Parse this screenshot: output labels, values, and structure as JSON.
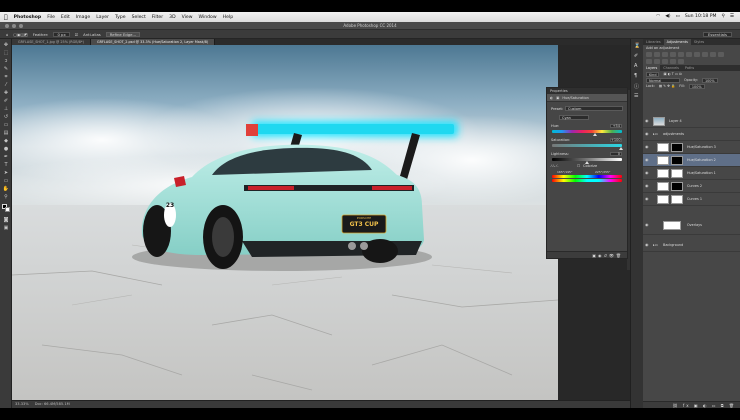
{
  "menubar": {
    "app_name": "Photoshop",
    "items": [
      "File",
      "Edit",
      "Image",
      "Layer",
      "Type",
      "Select",
      "Filter",
      "3D",
      "View",
      "Window",
      "Help"
    ],
    "clock": "Sun 10:18 PM"
  },
  "window": {
    "title": "Adobe Photoshop CC 2014"
  },
  "options": {
    "feather_label": "Feather:",
    "feather_value": "0 px",
    "antialias_label": "Anti-alias",
    "refine_edge": "Refine Edge...",
    "workspace": "Essentials"
  },
  "tabs": [
    {
      "label": "GRFLASE_SHOT_1.jpg @ 25% (RGB/8*)",
      "active": false
    },
    {
      "label": "GRFLASE_SHOT_2.psd @ 33.3% (Hue/Saturation 2, Layer Mask/8)",
      "active": true
    }
  ],
  "status": {
    "zoom": "33.33%",
    "doc": "Doc: 66.4M/585.1M"
  },
  "plate": {
    "brand": "PORSCHE",
    "text": "GT3 CUP"
  },
  "car_number": "23",
  "properties": {
    "panel_title": "Properties",
    "section": "Hue/Saturation",
    "preset_label": "Preset:",
    "preset_value": "Custom",
    "channel_value": "Cyan",
    "hue_label": "Hue:",
    "hue_value": "+54",
    "saturation_label": "Saturation:",
    "saturation_value": "+100",
    "lightness_label": "Lightness:",
    "lightness_value": "0",
    "colorize_label": "Colorize",
    "range_left": "165°/195°",
    "range_right": "225°/255°"
  },
  "right_panel": {
    "tabs": [
      {
        "label": "Libraries",
        "on": false
      },
      {
        "label": "Adjustments",
        "on": true
      },
      {
        "label": "Styles",
        "on": false
      }
    ],
    "adj_title": "Add an adjustment",
    "layer_tabs": [
      {
        "label": "Layers",
        "on": true
      },
      {
        "label": "Channels",
        "on": false
      },
      {
        "label": "Paths",
        "on": false
      }
    ],
    "kind": "Kind",
    "blend": "Normal",
    "opacity_label": "Opacity:",
    "opacity_value": "100%",
    "lock_label": "Lock:",
    "fill_label": "Fill:",
    "fill_value": "100%",
    "layers": [
      {
        "name": "Layer 4",
        "thumb": "photo",
        "sel": false
      },
      {
        "name": "adjustments",
        "thumb": "folder",
        "sel": false
      },
      {
        "name": "Hue/Saturation 3",
        "thumb": "mask-dark",
        "sel": false
      },
      {
        "name": "Hue/Saturation 2",
        "thumb": "mask-dark",
        "sel": true
      },
      {
        "name": "Hue/Saturation 1",
        "thumb": "mask-white",
        "sel": false
      },
      {
        "name": "Curves 2",
        "thumb": "mask-dark",
        "sel": false
      },
      {
        "name": "Curves 1",
        "thumb": "mask-white",
        "sel": false
      },
      {
        "name": "Overlays",
        "thumb": "folder",
        "sel": false
      },
      {
        "name": "Background",
        "thumb": "folder",
        "sel": false
      }
    ]
  }
}
